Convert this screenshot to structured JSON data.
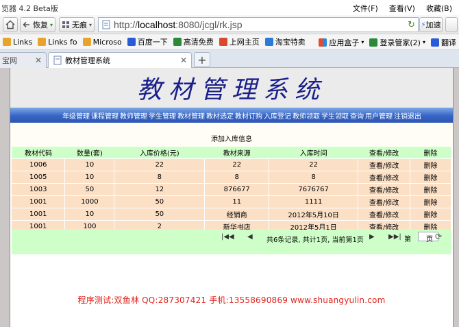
{
  "browser": {
    "title": "览器 4.2 Beta版",
    "menus": [
      "文件(F)",
      "查看(V)",
      "收藏(B)"
    ],
    "nav": {
      "restore": "恢复",
      "notrace": "无痕",
      "speed": "加速"
    },
    "url_prefix": "http://",
    "url_host": "localhost",
    "url_rest": ":8080/jcgl/rk.jsp",
    "bookmarks": [
      "Links",
      "Links fo",
      "Microso",
      "百度一下",
      "高清免费",
      "上网主页",
      "淘宝特卖"
    ],
    "bookmarks_right": [
      "应用盒子",
      "登录管家(2)",
      "翻译"
    ],
    "tabs": [
      {
        "label": "宝网"
      },
      {
        "label": "教材管理系统"
      }
    ]
  },
  "page": {
    "title": "教材管理系统",
    "menu": [
      "年级管理",
      "课程管理",
      "教师管理",
      "学生管理",
      "教材管理",
      "教材选定",
      "教材订购",
      "入库登记",
      "教师领取",
      "学生领取",
      "查询",
      "用户管理",
      "注销退出"
    ],
    "subtitle": "添加入库信息",
    "columns": [
      "教材代码",
      "数量(套)",
      "入库价格(元)",
      "教材来源",
      "入库时间",
      "查看/修改",
      "删除"
    ],
    "rows": [
      [
        "1006",
        "10",
        "22",
        "22",
        "22",
        "查看/修改",
        "删除"
      ],
      [
        "1005",
        "10",
        "8",
        "8",
        "8",
        "查看/修改",
        "删除"
      ],
      [
        "1003",
        "50",
        "12",
        "876677",
        "7676767",
        "查看/修改",
        "删除"
      ],
      [
        "1001",
        "1000",
        "50",
        "11",
        "1111",
        "查看/修改",
        "删除"
      ],
      [
        "1001",
        "10",
        "50",
        "经销商",
        "2012年5月10日",
        "查看/修改",
        "删除"
      ],
      [
        "1001",
        "100",
        "2",
        "新华书店",
        "2012年5月1日",
        "查看/修改",
        "删除"
      ]
    ],
    "pager": {
      "records": "共6条记录, 共计1页, 当前第1页",
      "page_label": "第",
      "page_suffix": "页"
    },
    "footer": "程序测试:双鱼林  QQ:287307421  手机:13558690869 www.shuangyulin.com"
  }
}
